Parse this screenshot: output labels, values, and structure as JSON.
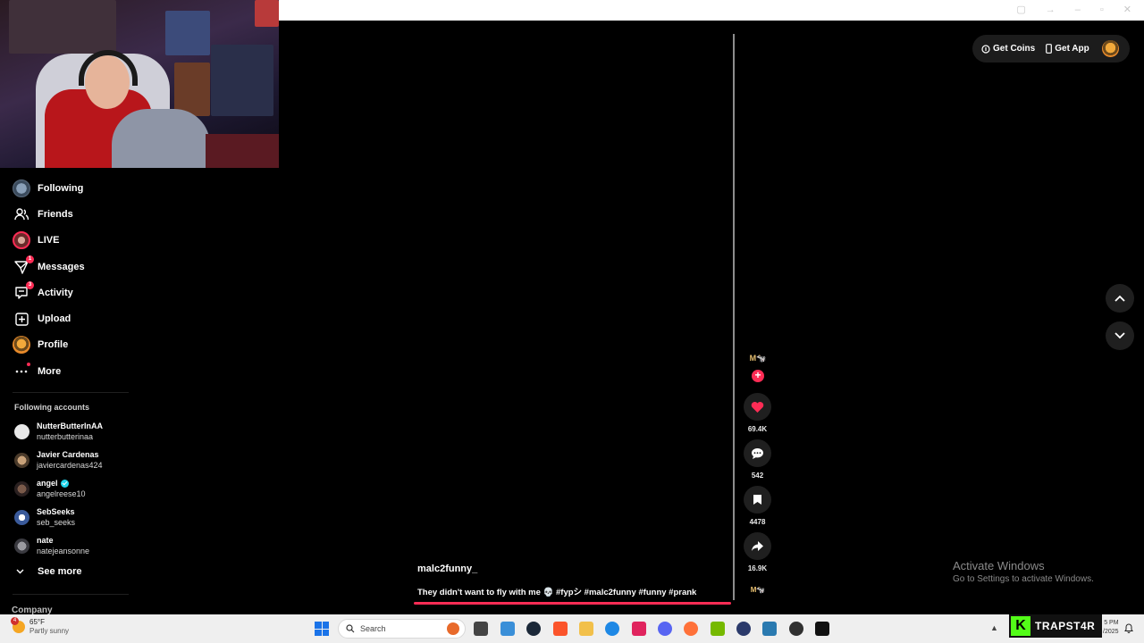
{
  "sidebar": {
    "nav": [
      {
        "label": "Following",
        "icon": "following-avatar-icon"
      },
      {
        "label": "Friends",
        "icon": "friends-icon"
      },
      {
        "label": "LIVE",
        "icon": "live-avatar-icon"
      },
      {
        "label": "Messages",
        "icon": "messages-icon",
        "badge": "1"
      },
      {
        "label": "Activity",
        "icon": "activity-icon",
        "badge": "3"
      },
      {
        "label": "Upload",
        "icon": "upload-icon"
      },
      {
        "label": "Profile",
        "icon": "profile-avatar-icon"
      },
      {
        "label": "More",
        "icon": "more-icon"
      }
    ],
    "following_title": "Following accounts",
    "accounts": [
      {
        "name": "NutterButterInAA",
        "username": "nutterbutterinaa",
        "verified": false
      },
      {
        "name": "Javier Cardenas",
        "username": "javiercardenas424",
        "verified": false
      },
      {
        "name": "angel",
        "username": "angelreese10",
        "verified": true
      },
      {
        "name": "SebSeeks",
        "username": "seb_seeks",
        "verified": false
      },
      {
        "name": "nate",
        "username": "natejeansonne",
        "verified": false
      }
    ],
    "see_more": "See more",
    "company": "Company"
  },
  "video": {
    "author": "malc2funny_",
    "caption": "They didn't want to fly with me 💀 #fypシ #malc2funny #funny #prank",
    "progress": 1.0
  },
  "actions": {
    "creator_avatar_text": "M🐄",
    "likes": "69.4K",
    "comments": "542",
    "saves": "4478",
    "shares": "16.9K",
    "music_disc_text": "M🐄"
  },
  "topbar": {
    "get_coins": "Get Coins",
    "get_app": "Get App"
  },
  "watermark": {
    "title": "Activate Windows",
    "subtitle": "Go to Settings to activate Windows."
  },
  "taskbar": {
    "weather_badge": "4",
    "temperature": "65°F",
    "condition": "Partly sunny",
    "search_placeholder": "Search",
    "stream_name": "TRAPST4R",
    "time": "5 PM",
    "date": "/2025"
  },
  "colors": {
    "accent": "#fe2c55",
    "background": "#000000",
    "button_bg": "#1f1f1f",
    "kick_green": "#53fc18"
  }
}
